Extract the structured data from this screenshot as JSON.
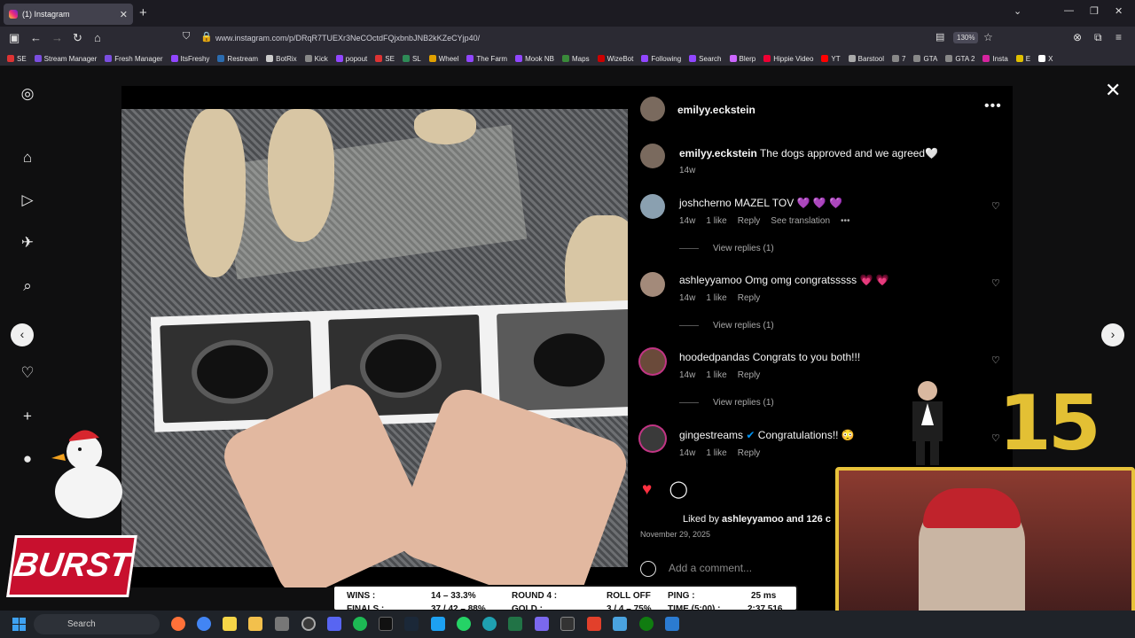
{
  "browser": {
    "tab_title": "(1) Instagram",
    "url": "www.instagram.com/p/DRqR7TUEXr3NeCOctdFQjxbnbJNB2kKZeCYjp40/",
    "zoom": "130%",
    "bookmarks": [
      "SE",
      "Stream Manager",
      "Fresh Manager",
      "ItsFreshy",
      "Restream",
      "BotRix",
      "Kick",
      "popout",
      "SE",
      "SL",
      "Wheel",
      "The Farm",
      "Mook NB",
      "Maps",
      "WizeBot",
      "Following",
      "Search",
      "Blerp",
      "Hippie Video",
      "YT",
      "Barstool",
      "7",
      "GTA",
      "GTA 2",
      "Insta",
      "E",
      "X"
    ]
  },
  "post": {
    "author": "emilyy.eckstein",
    "caption_user": "emilyy.eckstein",
    "caption_text": "The dogs approved and we agreed🤍",
    "caption_time": "14w",
    "comments": [
      {
        "user": "joshcherno",
        "text": "MAZEL TOV 💜 💜 💜",
        "time": "14w",
        "likes": "1 like",
        "reply": "Reply",
        "extra": "See translation",
        "view_replies": "View replies (1)"
      },
      {
        "user": "ashleyyamoo",
        "text": "Omg omg congratsssss 💗 💗",
        "time": "14w",
        "likes": "1 like",
        "reply": "Reply",
        "view_replies": "View replies (1)"
      },
      {
        "user": "hoodedpandas",
        "text": "Congrats to you both!!!",
        "time": "14w",
        "likes": "1 like",
        "reply": "Reply",
        "view_replies": "View replies (1)"
      },
      {
        "user": "gingestreams",
        "text": "Congratulations!! 😳",
        "time": "14w",
        "likes": "1 like",
        "reply": "Reply"
      }
    ],
    "liked_by_prefix": "Liked by",
    "liked_by_user": "ashleyyamoo",
    "liked_by_suffix": "and 126 c",
    "date": "November 29, 2025",
    "add_comment_placeholder": "Add a comment..."
  },
  "overlay": {
    "counter": "15",
    "logo_text": "BURST",
    "stats_row1": {
      "a": "WINS :",
      "b": "14 – 33.3%",
      "c": "ROUND 4 :",
      "d": "ROLL OFF",
      "e": "PING :",
      "f": "25 ms"
    },
    "stats_row2": {
      "a": "FINALS :",
      "b": "37 / 42 – 88%",
      "c": "GOLD :",
      "d": "3 / 4 – 75%",
      "e": "TIME (5:00) :",
      "f": "2:37.516"
    }
  },
  "taskbar": {
    "search_label": "Search"
  },
  "colors": {
    "heart": "#ff3040",
    "verified": "#0095f6",
    "accent": "#e3c034",
    "burst": "#c8102e"
  }
}
